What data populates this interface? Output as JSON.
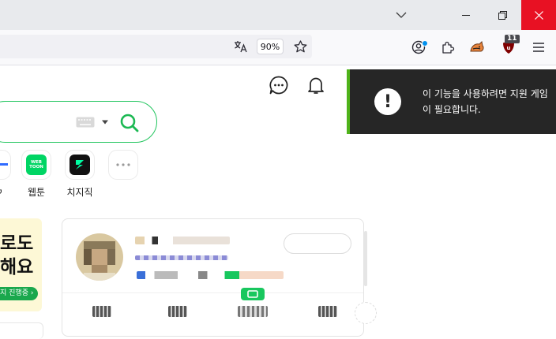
{
  "browser": {
    "zoom": "90%",
    "ublock_count": "11",
    "colors": {
      "close": "#e81123",
      "titlebar": "#e8eaed",
      "toolbar": "#f9f9fb"
    },
    "icons": [
      "chevron-down-icon",
      "minimize-icon",
      "restore-icon",
      "close-icon",
      "translate-icon",
      "star-icon",
      "account-icon",
      "puzzle-icon",
      "cat-icon",
      "ublock-icon",
      "hamburger-menu-icon"
    ]
  },
  "page": {
    "icons": [
      "chat-icon",
      "bell-icon",
      "shopping-bag-icon",
      "keyboard-icon",
      "search-icon"
    ],
    "shortcuts": [
      {
        "label": "",
        "icon": "partial-shortcut-icon"
      },
      {
        "label": "웹툰",
        "icon": "webtoon-icon",
        "tile_text": "WEBTOON"
      },
      {
        "label": "치지직",
        "icon": "chzzk-icon"
      },
      {
        "label": "",
        "icon": "more-icon"
      }
    ],
    "promo": {
      "line1": "로도",
      "line2": "해요",
      "button": "지 진행중 ›"
    },
    "accent": "#22c55e"
  },
  "notification": {
    "message": "이 기능을 사용하려면 지원 게임이 필요합니다.",
    "icon": "exclamation-icon",
    "accent": "#4fb31a"
  }
}
